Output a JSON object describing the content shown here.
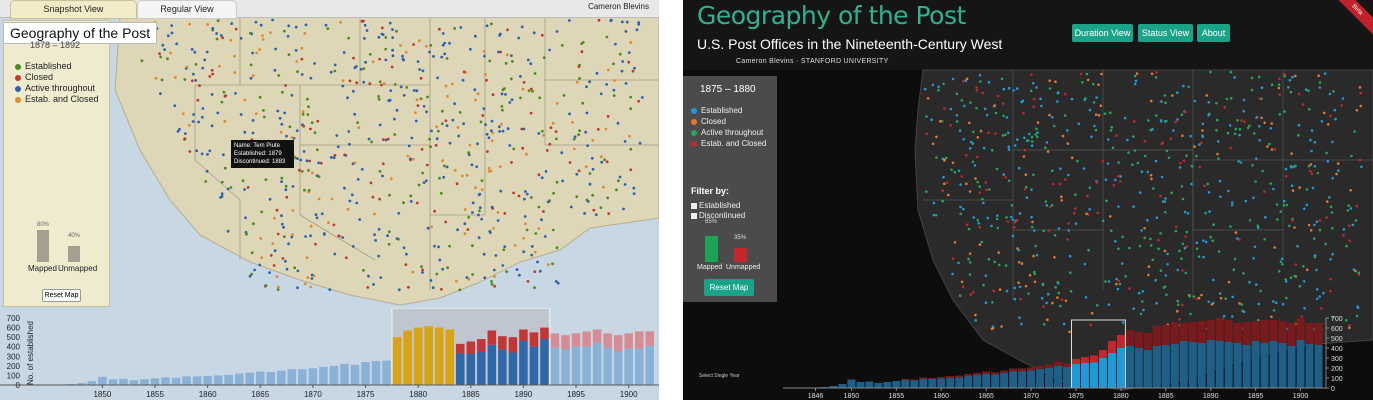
{
  "left": {
    "tabs": [
      "Snapshot View",
      "Regular View"
    ],
    "author": "Cameron Blevins",
    "title": "Geography of the Post",
    "date_range": "1878 – 1892",
    "legend": [
      {
        "label": "Established",
        "color": "#4f8a1e"
      },
      {
        "label": "Closed",
        "color": "#c0392b"
      },
      {
        "label": "Active throughout",
        "color": "#2c62b6"
      },
      {
        "label": "Estab. and Closed",
        "color": "#e08a2c"
      }
    ],
    "mapped": {
      "label": "Mapped",
      "percent": "80%",
      "value": 80
    },
    "unmapped": {
      "label": "Unmapped",
      "percent": "40%",
      "value": 40
    },
    "reset_label": "Reset Map",
    "tooltip": {
      "name": "Name: Tem Piute",
      "established": "Established: 1879",
      "discontinued": "Discontinued: 1883"
    },
    "chart_data": {
      "type": "bar",
      "ylabel": "No. of established",
      "ylim": [
        0,
        700
      ],
      "yticks": [
        "0",
        "100",
        "200",
        "300",
        "400",
        "500",
        "600",
        "700"
      ],
      "xticks": [
        "1850",
        "1855",
        "1860",
        "1865",
        "1870",
        "1875",
        "1880",
        "1885",
        "1890",
        "1895",
        "1900"
      ],
      "xrange": [
        1846,
        1903
      ],
      "highlight_range": [
        1878,
        1892
      ],
      "gold_range": [
        1878,
        1883
      ],
      "years": [
        1846,
        1847,
        1848,
        1849,
        1850,
        1851,
        1852,
        1853,
        1854,
        1855,
        1856,
        1857,
        1858,
        1859,
        1860,
        1861,
        1862,
        1863,
        1864,
        1865,
        1866,
        1867,
        1868,
        1869,
        1870,
        1871,
        1872,
        1873,
        1874,
        1875,
        1876,
        1877,
        1878,
        1879,
        1880,
        1881,
        1882,
        1883,
        1884,
        1885,
        1886,
        1887,
        1888,
        1889,
        1890,
        1891,
        1892,
        1893,
        1894,
        1895,
        1896,
        1897,
        1898,
        1899,
        1900,
        1901,
        1902
      ],
      "established": [
        5,
        10,
        20,
        40,
        85,
        60,
        65,
        50,
        60,
        70,
        80,
        75,
        90,
        90,
        95,
        100,
        105,
        120,
        130,
        140,
        135,
        150,
        165,
        165,
        175,
        190,
        200,
        220,
        210,
        240,
        250,
        255,
        500,
        570,
        600,
        615,
        600,
        580,
        430,
        455,
        480,
        570,
        510,
        500,
        580,
        550,
        600,
        540,
        520,
        540,
        560,
        580,
        540,
        520,
        540,
        560,
        560
      ],
      "closed": [
        0,
        0,
        0,
        0,
        0,
        0,
        0,
        0,
        0,
        0,
        0,
        0,
        0,
        0,
        0,
        0,
        0,
        0,
        0,
        0,
        0,
        0,
        0,
        0,
        0,
        0,
        0,
        0,
        0,
        0,
        0,
        0,
        0,
        0,
        0,
        0,
        0,
        0,
        100,
        130,
        130,
        150,
        140,
        160,
        120,
        150,
        120,
        150,
        150,
        140,
        160,
        140,
        150,
        170,
        160,
        180,
        150
      ]
    }
  },
  "right": {
    "title": "Geography of the Post",
    "subtitle": "U.S. Post Offices in the Nineteenth-Century West",
    "author": "Cameron Blevins  ·  STANFORD UNIVERSITY",
    "nav": [
      "Duration View",
      "Status View",
      "About"
    ],
    "beta": "Beta",
    "date_range": "1875 – 1880",
    "legend": [
      {
        "label": "Established",
        "color": "#1f9ad6"
      },
      {
        "label": "Closed",
        "color": "#e8772e"
      },
      {
        "label": "Active throughout",
        "color": "#23a55a"
      },
      {
        "label": "Estab. and Closed",
        "color": "#c4262b"
      }
    ],
    "filter_title": "Filter by:",
    "filter_items": [
      "Established",
      "Discontinued"
    ],
    "mapped": {
      "label": "Mapped",
      "percent": "65%",
      "value": 65
    },
    "unmapped": {
      "label": "Unmapped",
      "percent": "35%",
      "value": 35
    },
    "reset_label": "Reset Map",
    "single_year_label": "Select Single Year",
    "chart_data": {
      "type": "bar",
      "ylim": [
        0,
        700
      ],
      "yticks": [
        "0",
        "100",
        "200",
        "300",
        "400",
        "500",
        "600",
        "700"
      ],
      "xticks": [
        "1846",
        "1850",
        "1855",
        "1860",
        "1865",
        "1870",
        "1875",
        "1880",
        "1885",
        "1890",
        "1895",
        "1900"
      ],
      "xrange": [
        1846,
        1903
      ],
      "highlight_range": [
        1875,
        1880
      ],
      "years": [
        1846,
        1847,
        1848,
        1849,
        1850,
        1851,
        1852,
        1853,
        1854,
        1855,
        1856,
        1857,
        1858,
        1859,
        1860,
        1861,
        1862,
        1863,
        1864,
        1865,
        1866,
        1867,
        1868,
        1869,
        1870,
        1871,
        1872,
        1873,
        1874,
        1875,
        1876,
        1877,
        1878,
        1879,
        1880,
        1881,
        1882,
        1883,
        1884,
        1885,
        1886,
        1887,
        1888,
        1889,
        1890,
        1891,
        1892,
        1893,
        1894,
        1895,
        1896,
        1897,
        1898,
        1899,
        1900,
        1901,
        1902
      ],
      "established": [
        5,
        10,
        20,
        40,
        85,
        60,
        65,
        50,
        60,
        70,
        80,
        75,
        90,
        90,
        95,
        100,
        105,
        120,
        130,
        140,
        135,
        150,
        165,
        165,
        175,
        190,
        200,
        220,
        210,
        240,
        250,
        255,
        300,
        350,
        400,
        420,
        400,
        380,
        420,
        430,
        440,
        470,
        460,
        450,
        480,
        470,
        460,
        450,
        430,
        470,
        450,
        470,
        450,
        420,
        480,
        440,
        430
      ],
      "closed": [
        0,
        0,
        0,
        0,
        0,
        0,
        0,
        0,
        0,
        0,
        10,
        10,
        15,
        10,
        15,
        20,
        20,
        20,
        20,
        25,
        20,
        25,
        30,
        30,
        30,
        30,
        35,
        40,
        40,
        50,
        60,
        70,
        80,
        120,
        130,
        160,
        160,
        170,
        200,
        200,
        220,
        180,
        200,
        220,
        200,
        230,
        220,
        200,
        230,
        200,
        230,
        210,
        220,
        230,
        220,
        210,
        220
      ]
    }
  }
}
